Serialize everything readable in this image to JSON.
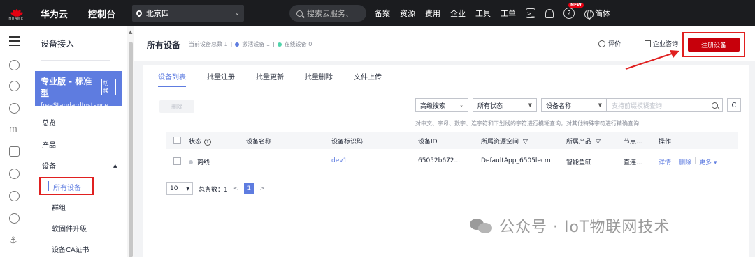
{
  "topbar": {
    "brand_sub": "HUAWEI",
    "brand": "华为云",
    "console": "控制台",
    "region": "北京四",
    "search_placeholder": "搜索云服务、",
    "nav": [
      "备案",
      "资源",
      "费用",
      "企业",
      "工具",
      "工单"
    ],
    "new_badge": "NEW",
    "language": "简体"
  },
  "sidebar": {
    "title": "设备接入",
    "instance": {
      "name": "专业版 - 标准型",
      "switch": "切换",
      "id": "freeStandardInstance"
    },
    "items": {
      "overview": "总览",
      "product": "产品",
      "device": "设备",
      "all_devices": "所有设备",
      "group": "群组",
      "firmware": "软固件升级",
      "ca": "设备CA证书"
    }
  },
  "header": {
    "title": "所有设备",
    "total_label": "当前设备总数 1",
    "activated_label": "激活设备 1",
    "online_label": "在线设备 0",
    "rate": "评价",
    "consult": "企业咨询",
    "register": "注册设备"
  },
  "tabs": [
    "设备列表",
    "批量注册",
    "批量更新",
    "批量删除",
    "文件上传"
  ],
  "toolbar": {
    "delete": "删除",
    "advanced": "高级搜索",
    "status": "所有状态",
    "field": "设备名称",
    "search_placeholder": "支持前缀模糊查询",
    "hint": "对中文、字母、数字、连字符和下划线的字符进行模糊查询，对其他特殊字符进行精确查询"
  },
  "table": {
    "headers": [
      "状态",
      "设备名称",
      "设备标识码",
      "设备ID",
      "所属资源空间",
      "所属产品",
      "节点...",
      "操作"
    ],
    "rows": [
      {
        "status": "离线",
        "name": "",
        "identifier": "dev1",
        "id": "65052b672...",
        "space": "DefaultApp_6505lecm",
        "product": "智能鱼缸",
        "node": "直连...",
        "actions": [
          "详情",
          "删除",
          "更多"
        ]
      }
    ]
  },
  "pager": {
    "size": "10",
    "total": "总条数：1",
    "page": "1"
  },
  "watermark": "公众号 · IoT物联网技术",
  "colors": {
    "accent": "#5e7ce0",
    "danger": "#c7000b",
    "highlight": "#e02020"
  }
}
